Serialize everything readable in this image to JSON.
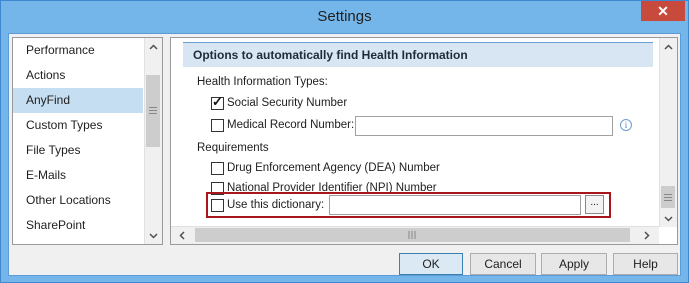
{
  "window": {
    "title": "Settings",
    "close_glyph": "✕"
  },
  "sidebar": {
    "items": [
      {
        "label": "Performance"
      },
      {
        "label": "Actions"
      },
      {
        "label": "AnyFind"
      },
      {
        "label": "Custom Types"
      },
      {
        "label": "File Types"
      },
      {
        "label": "E-Mails"
      },
      {
        "label": "Other Locations"
      },
      {
        "label": "SharePoint"
      }
    ],
    "selected": "AnyFind"
  },
  "panel": {
    "header": "Options to automatically find Health Information",
    "health_types_label": "Health Information Types:",
    "ssn": {
      "label": "Social Security Number",
      "checked": true
    },
    "mrn": {
      "label": "Medical Record Number:",
      "checked": false,
      "value": ""
    },
    "requirements_label": "Requirements",
    "dea": {
      "label": "Drug Enforcement Agency (DEA) Number",
      "checked": false
    },
    "npi": {
      "label": "National Provider Identifier (NPI) Number",
      "checked": false
    },
    "dictionary": {
      "label": "Use this dictionary:",
      "checked": false,
      "value": "",
      "browse_label": "..."
    },
    "info_glyph": "i"
  },
  "buttons": {
    "ok": "OK",
    "cancel": "Cancel",
    "apply": "Apply",
    "help": "Help"
  },
  "colors": {
    "highlight_box": "#a6161c",
    "selection": "#c6def1",
    "header_bg": "#d8e6f4"
  }
}
